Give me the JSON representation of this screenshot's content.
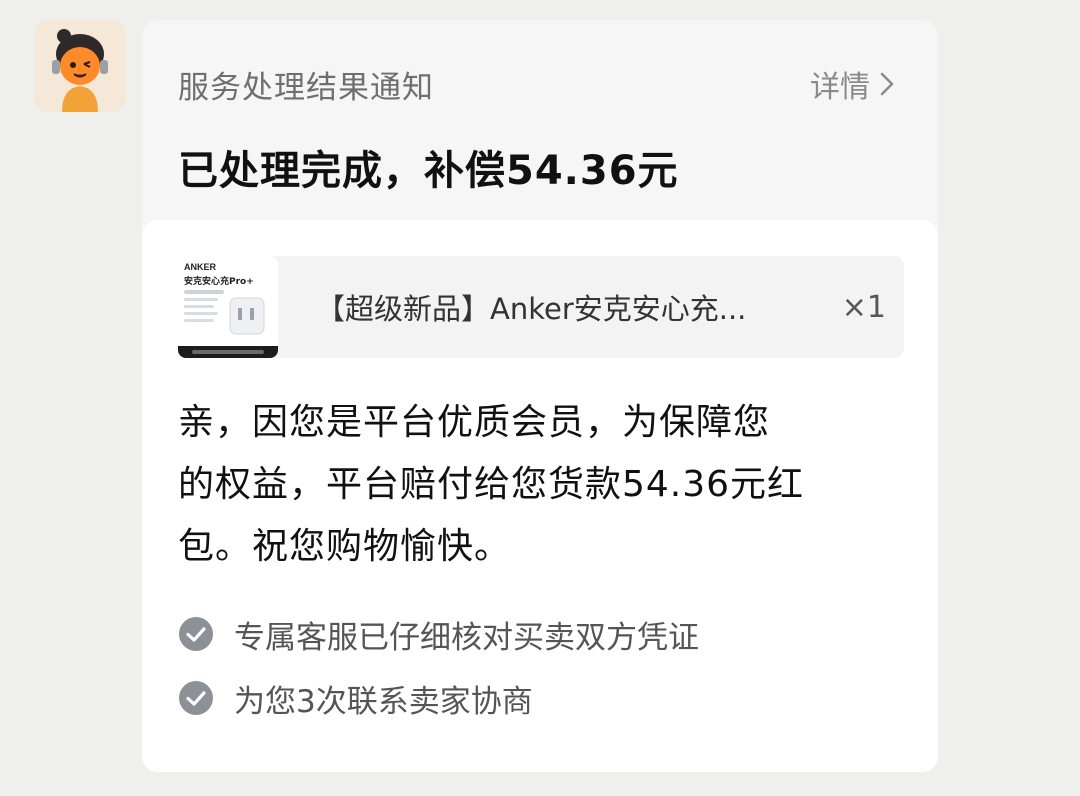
{
  "notice": {
    "title": "服务处理结果通知",
    "detail_label": "详情",
    "headline": "已处理完成，补偿54.36元"
  },
  "product": {
    "name": "【超级新品】Anker安克安心充...",
    "quantity": "×1",
    "thumb_brand": "ANKER",
    "thumb_title": "安克安心充Pro+"
  },
  "message": {
    "line1": "亲，因您是平台优质会员，为保障您",
    "line2": "的权益，平台赔付给您货款54.36元红",
    "line3": "包。祝您购物愉快。"
  },
  "checks": [
    {
      "label": "专属客服已仔细核对买卖双方凭证",
      "icon": "check-circle-icon"
    },
    {
      "label": "为您3次联系卖家协商",
      "icon": "check-circle-icon"
    }
  ],
  "colors": {
    "background": "#efefed",
    "card": "#f6f6f6",
    "body_card": "#ffffff",
    "check_icon": "#8c9097"
  }
}
